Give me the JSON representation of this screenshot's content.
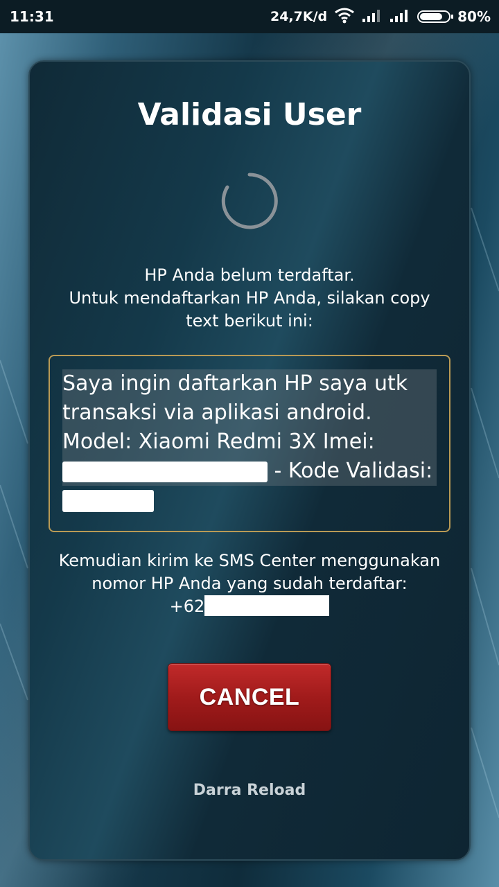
{
  "status_bar": {
    "time": "11:31",
    "network_speed": "24,7K/d",
    "battery_percent": "80%",
    "battery_level": 0.8
  },
  "dialog": {
    "title": "Validasi User",
    "info_lines": [
      "HP Anda belum terdaftar.",
      "Untuk mendaftarkan HP Anda, silakan copy",
      "text berikut ini:"
    ],
    "copy_text": {
      "line1": "Saya ingin daftarkan HP saya utk",
      "line2": "transaksi via aplikasi android.",
      "line3": "Model: Xiaomi Redmi 3X Imei:",
      "line4_suffix": "- Kode Validasi:"
    },
    "sms_lines": [
      "Kemudian kirim ke SMS Center menggunakan",
      "nomor HP Anda yang sudah terdaftar:"
    ],
    "phone_prefix": "+62",
    "cancel_label": "CANCEL",
    "footer": "Darra Reload"
  },
  "colors": {
    "accent_border": "#b99a55",
    "cancel_button": "#a11b1b",
    "spinner": "#8a9298"
  },
  "icons": [
    "wifi-icon",
    "signal-icon",
    "battery-icon",
    "loading-spinner-icon"
  ]
}
